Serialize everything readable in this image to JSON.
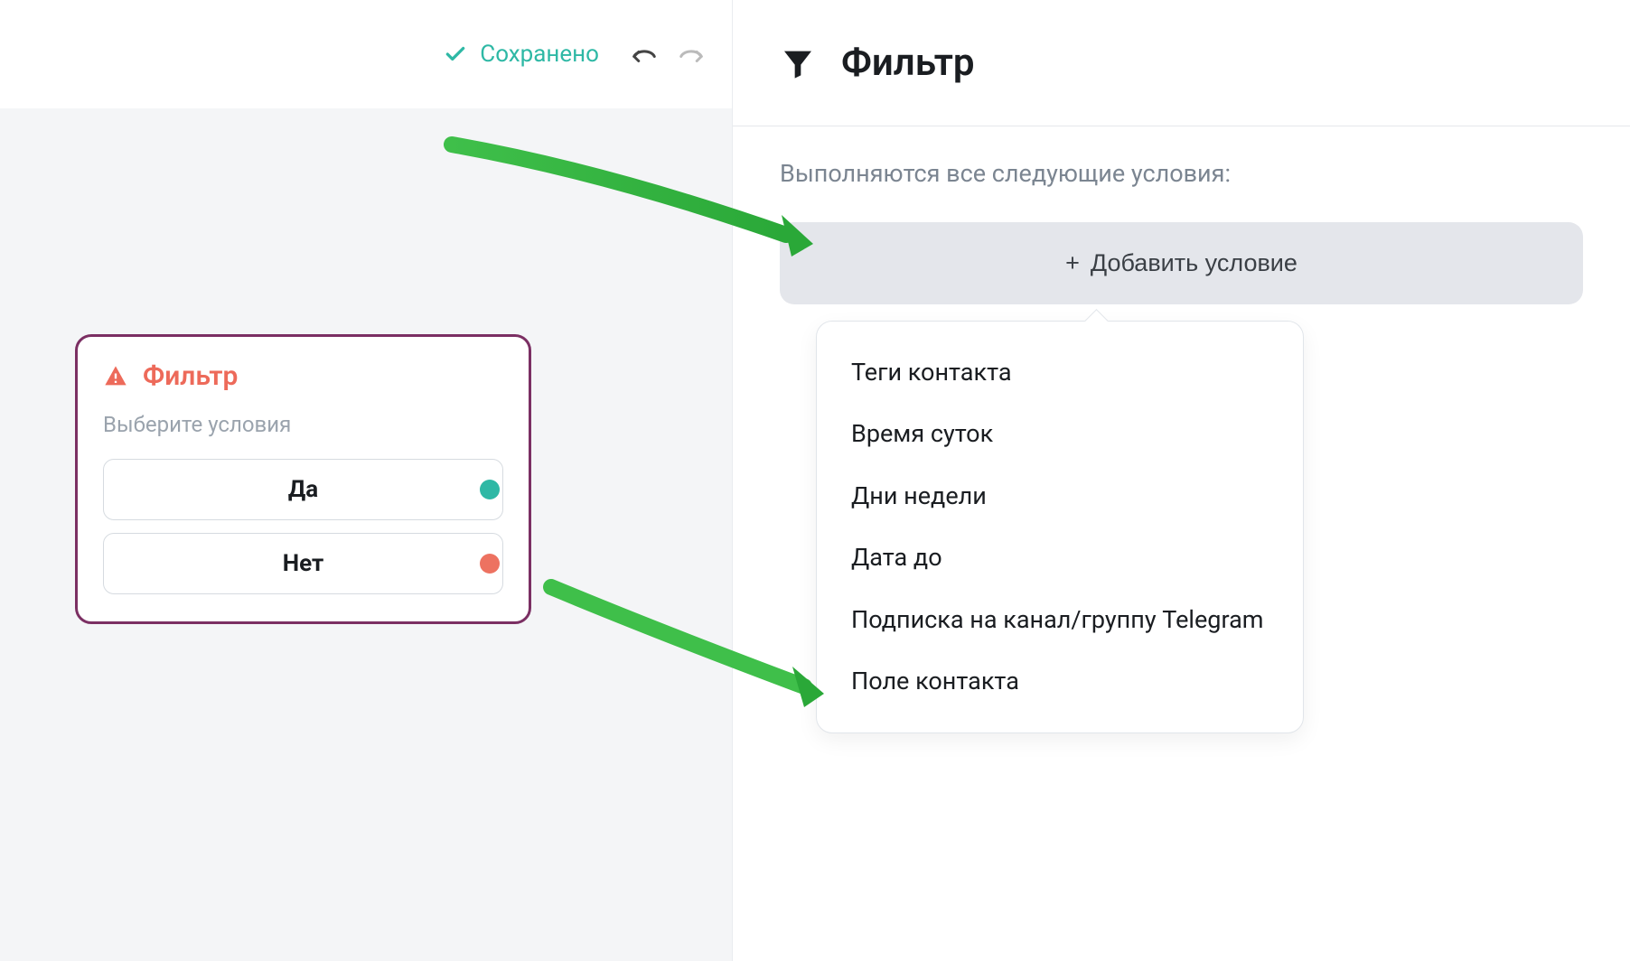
{
  "top": {
    "saved_label": "Сохранено"
  },
  "node": {
    "title": "Фильтр",
    "subtitle": "Выберите условия",
    "yes": "Да",
    "no": "Нет"
  },
  "panel": {
    "title": "Фильтр",
    "conditions_label": "Выполняются все следующие условия:",
    "add_label": "Добавить условие",
    "options": [
      "Теги контакта",
      "Время суток",
      "Дни недели",
      "Дата до",
      "Подписка на канал/группу Telegram",
      "Поле контакта"
    ]
  }
}
